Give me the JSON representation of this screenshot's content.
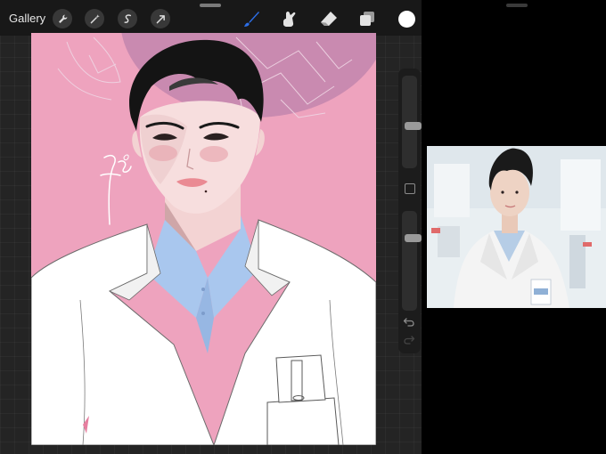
{
  "toolbar": {
    "gallery_label": "Gallery",
    "left_tools": [
      "wrench-icon",
      "magic-wand-icon",
      "selection-icon",
      "transform-arrow-icon"
    ],
    "right_tools": [
      "brush-icon",
      "smudge-icon",
      "eraser-icon",
      "layers-icon"
    ],
    "active_tool": "brush-icon",
    "accent_color": "#2d6fe8",
    "current_color": "#ffffff"
  },
  "canvas": {
    "background_color": "#eea3be",
    "circle_color": "#c98ab0",
    "coat_color": "#ffffff",
    "shirt_color": "#a9c7ee",
    "hair_color": "#141414",
    "skin_color": "#f7dede"
  },
  "sidebar": {
    "brush_size": 0.45,
    "opacity": 0.55
  },
  "reference": {
    "background_color": "#e9eff2"
  }
}
